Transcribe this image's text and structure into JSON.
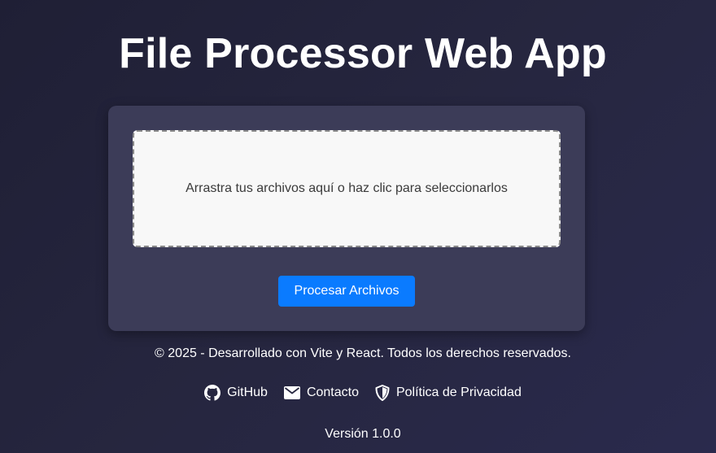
{
  "app": {
    "title": "File Processor Web App"
  },
  "dropzone": {
    "text": "Arrastra tus archivos aquí o haz clic para seleccionarlos"
  },
  "actions": {
    "process_label": "Procesar Archivos"
  },
  "footer": {
    "copyright": "© 2025 - Desarrollado con Vite y React. Todos los derechos reservados.",
    "links": [
      {
        "label": "GitHub",
        "icon": "github-icon"
      },
      {
        "label": "Contacto",
        "icon": "envelope-icon"
      },
      {
        "label": "Política de Privacidad",
        "icon": "shield-icon"
      }
    ],
    "version": "Versión 1.0.0"
  },
  "colors": {
    "background": "#26263f",
    "card": "#3c3c58",
    "dropzone": "#f8f8f8",
    "button": "#0a7bff",
    "text": "#ffffff"
  }
}
